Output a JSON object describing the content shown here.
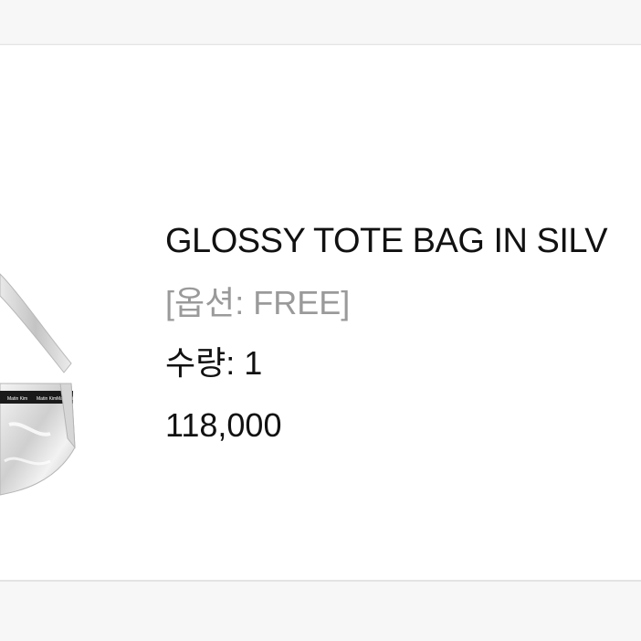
{
  "product": {
    "name": "GLOSSY TOTE BAG IN SILV",
    "option": "[옵션: FREE]",
    "quantity": "수량: 1",
    "price": "118,000",
    "image": {
      "icon": "silver-tote-bag-image",
      "colors": {
        "body": "#d9d9d9",
        "highlight": "#f5f5f5",
        "band": "#1a1a1a"
      }
    }
  }
}
